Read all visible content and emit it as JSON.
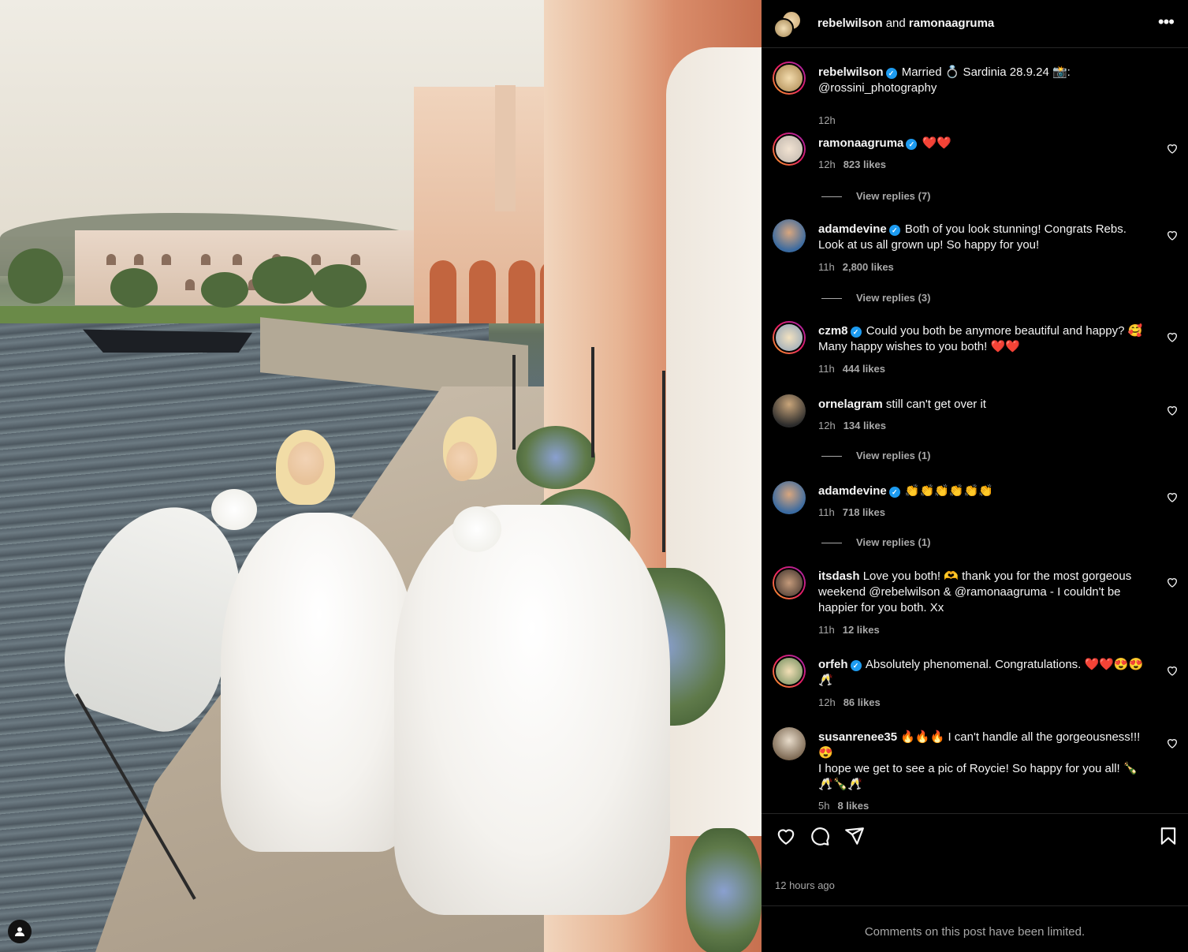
{
  "header": {
    "user1": "rebelwilson",
    "and": " and ",
    "user2": "ramonaagruma",
    "more_label": "•••"
  },
  "caption": {
    "username": "rebelwilson",
    "text": "Married 💍 Sardinia 28.9.24 📸: @rossini_photography",
    "time": "12h"
  },
  "comments": [
    {
      "username": "ramonaagruma",
      "verified": true,
      "text": "❤️❤️",
      "time": "12h",
      "likes": "823 likes",
      "replies": "View replies (7)"
    },
    {
      "username": "adamdevine",
      "verified": true,
      "text": "Both of you look stunning! Congrats Rebs. Look at us all grown up! So happy for you!",
      "time": "11h",
      "likes": "2,800 likes",
      "replies": "View replies (3)"
    },
    {
      "username": "czm8",
      "verified": true,
      "text": "Could you both be anymore beautiful and happy? 🥰 Many happy wishes to you both! ❤️❤️",
      "time": "11h",
      "likes": "444 likes"
    },
    {
      "username": "ornelagram",
      "verified": false,
      "text": "still can't get over it",
      "time": "12h",
      "likes": "134 likes",
      "replies": "View replies (1)"
    },
    {
      "username": "adamdevine",
      "verified": true,
      "text": "👏👏👏👏👏👏",
      "time": "11h",
      "likes": "718 likes",
      "replies": "View replies (1)"
    },
    {
      "username": "itsdash",
      "verified": false,
      "text": "Love you both! 🫶 thank you for the most gorgeous weekend @rebelwilson & @ramonaagruma - I couldn't be happier for you both. Xx",
      "time": "11h",
      "likes": "12 likes"
    },
    {
      "username": "orfeh",
      "verified": true,
      "text": "Absolutely phenomenal. Congratulations. ❤️❤️😍😍🥂",
      "time": "12h",
      "likes": "86 likes"
    },
    {
      "username": "susanrenee35",
      "verified": false,
      "text": "🔥🔥🔥 I can't handle all the gorgeousness!!! 😍",
      "text2": "I hope we get to see a pic of Roycie! So happy for you all! 🍾🥂🍾🥂",
      "time": "5h",
      "likes": "8 likes"
    }
  ],
  "post_time": "12 hours ago",
  "footer_text": "Comments on this post have been limited.",
  "icons": {
    "like": "heart-icon",
    "comment": "comment-icon",
    "share": "share-icon",
    "save": "bookmark-icon",
    "more": "more-icon",
    "verified": "verified-badge-icon",
    "photo_user": "user-tag-icon"
  },
  "colors": {
    "background": "#000000",
    "text": "#f5f5f5",
    "secondary_text": "#a8a8a8",
    "divider": "#262626",
    "verified": "#1d9bf0"
  }
}
